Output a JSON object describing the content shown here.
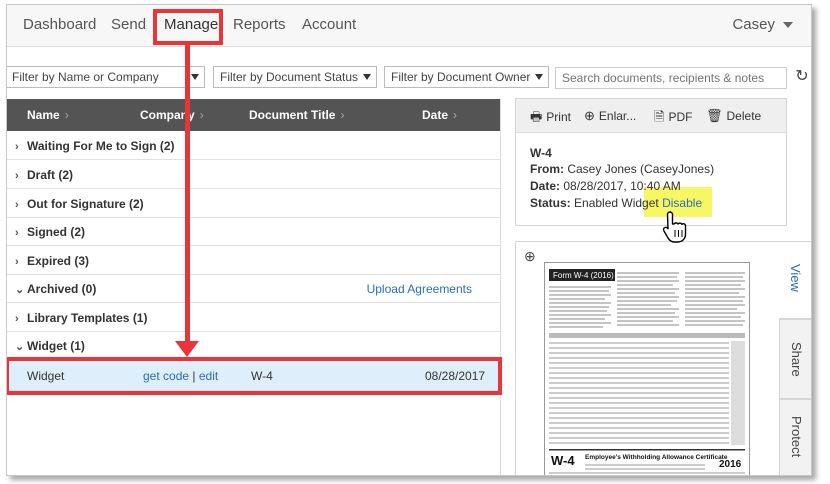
{
  "nav": {
    "items": [
      "Dashboard",
      "Send",
      "Manage",
      "Reports",
      "Account"
    ],
    "user": "Casey"
  },
  "filters": {
    "name_company": "Filter by Name or Company",
    "status": "Filter by Document Status",
    "owner": "Filter by Document Owner",
    "search_placeholder": "Search documents, recipients & notes"
  },
  "list": {
    "headers": [
      "Name",
      "Company",
      "Document Title",
      "Date"
    ],
    "groups": [
      {
        "label": "Waiting For Me to Sign (2)",
        "expanded": false
      },
      {
        "label": "Draft (2)",
        "expanded": false
      },
      {
        "label": "Out for Signature (2)",
        "expanded": false
      },
      {
        "label": "Signed (2)",
        "expanded": false
      },
      {
        "label": "Expired (3)",
        "expanded": false
      },
      {
        "label": "Archived (0)",
        "expanded": true
      },
      {
        "label": "Library Templates (1)",
        "expanded": false
      },
      {
        "label": "Widget (1)",
        "expanded": true
      }
    ],
    "upload_link": "Upload Agreements",
    "selected_row": {
      "name": "Widget",
      "get_code": "get code",
      "separator": "|",
      "edit": "edit",
      "title": "W-4",
      "date": "08/28/2017"
    }
  },
  "detail": {
    "toolbar": [
      "Print",
      "Enlar...",
      "PDF",
      "Delete"
    ],
    "doc_name": "W-4",
    "from_label": "From:",
    "from_value": "Casey Jones (CaseyJones)",
    "date_label": "Date:",
    "date_value": "08/28/2017, 10:40 AM",
    "status_label": "Status:",
    "status_value": "Enabled Widget",
    "disable_link": "Disable"
  },
  "preview": {
    "form_title": "Form W-4 (2016)",
    "cert_code": "W-4",
    "cert_title": "Employee's Withholding Allowance Certificate",
    "year": "2016"
  },
  "side_tabs": [
    "View",
    "Share",
    "Protect"
  ],
  "colors": {
    "accent": "#2a6fb5",
    "annotation": "#e8353b",
    "header_bg": "#545454",
    "highlight": "#f6f44a"
  }
}
